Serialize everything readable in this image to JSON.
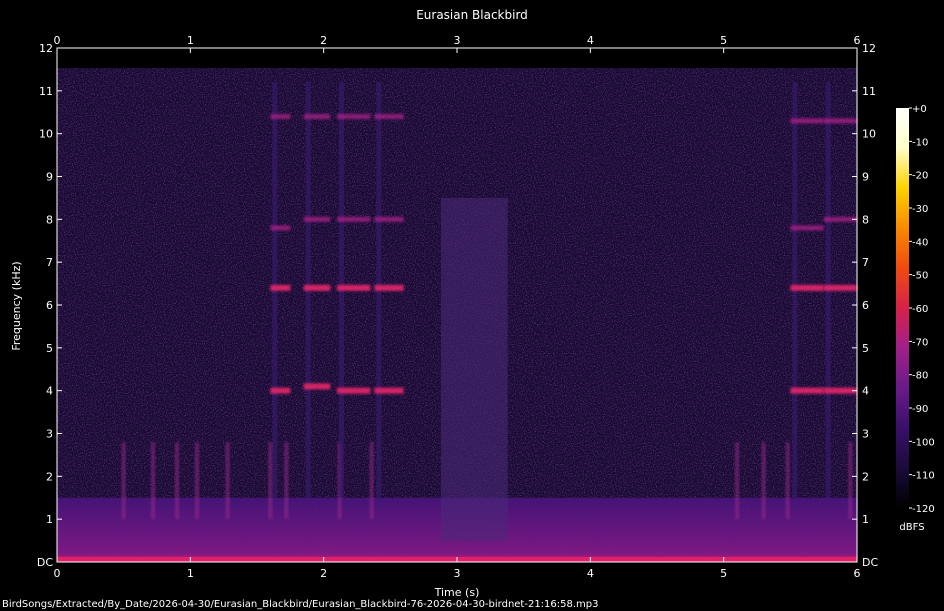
{
  "chart_data": {
    "type": "heatmap",
    "title": "Eurasian Blackbird",
    "xlabel": "Time (s)",
    "ylabel": "Frequency (kHz)",
    "xlim": [
      0,
      6
    ],
    "ylim": [
      0,
      12
    ],
    "x_ticks": [
      "0",
      "1",
      "2",
      "3",
      "4",
      "5",
      "6"
    ],
    "y_ticks": [
      "DC",
      "1",
      "2",
      "3",
      "4",
      "5",
      "6",
      "7",
      "8",
      "9",
      "10",
      "11",
      "12"
    ],
    "colorbar": {
      "unit": "dBFS",
      "ticks": [
        "+0",
        "-10",
        "-20",
        "-30",
        "-40",
        "-50",
        "-60",
        "-70",
        "-80",
        "-90",
        "-100",
        "-110",
        "-120"
      ],
      "range": [
        -120,
        0
      ],
      "colors": [
        "#000000",
        "#1a0b3a",
        "#3a0f6a",
        "#6a1a8a",
        "#a0208a",
        "#d8204a",
        "#f04a10",
        "#f88a00",
        "#fcd200",
        "#ffffc8",
        "#ffffff"
      ]
    },
    "background_color": "#160a30",
    "low_band_color": "#5a1888",
    "song_phrases": [
      {
        "start_s": 1.6,
        "end_s": 1.75,
        "harmonics_khz": [
          4.0,
          6.4,
          7.8,
          10.4
        ]
      },
      {
        "start_s": 1.85,
        "end_s": 2.05,
        "harmonics_khz": [
          4.1,
          6.4,
          8.0,
          10.4
        ]
      },
      {
        "start_s": 2.1,
        "end_s": 2.35,
        "harmonics_khz": [
          4.0,
          6.4,
          8.0,
          10.4
        ]
      },
      {
        "start_s": 2.38,
        "end_s": 2.6,
        "harmonics_khz": [
          4.0,
          6.4,
          8.0,
          10.4
        ]
      },
      {
        "start_s": 5.5,
        "end_s": 5.75,
        "harmonics_khz": [
          4.0,
          6.4,
          7.8,
          10.3
        ]
      },
      {
        "start_s": 5.75,
        "end_s": 6.0,
        "harmonics_khz": [
          4.0,
          6.4,
          8.0,
          10.3
        ]
      }
    ],
    "noise_burst": {
      "start_s": 2.88,
      "end_s": 3.38,
      "low_khz": 0.5,
      "high_khz": 8.5
    },
    "clicks_s": [
      0.5,
      0.72,
      0.9,
      1.05,
      1.28,
      1.6,
      1.72,
      2.12,
      2.36,
      5.1,
      5.3,
      5.48,
      5.95
    ]
  },
  "footer": {
    "file_path": "BirdSongs/Extracted/By_Date/2026-04-30/Eurasian_Blackbird/Eurasian_Blackbird-76-2026-04-30-birdnet-21:16:58.mp3"
  }
}
